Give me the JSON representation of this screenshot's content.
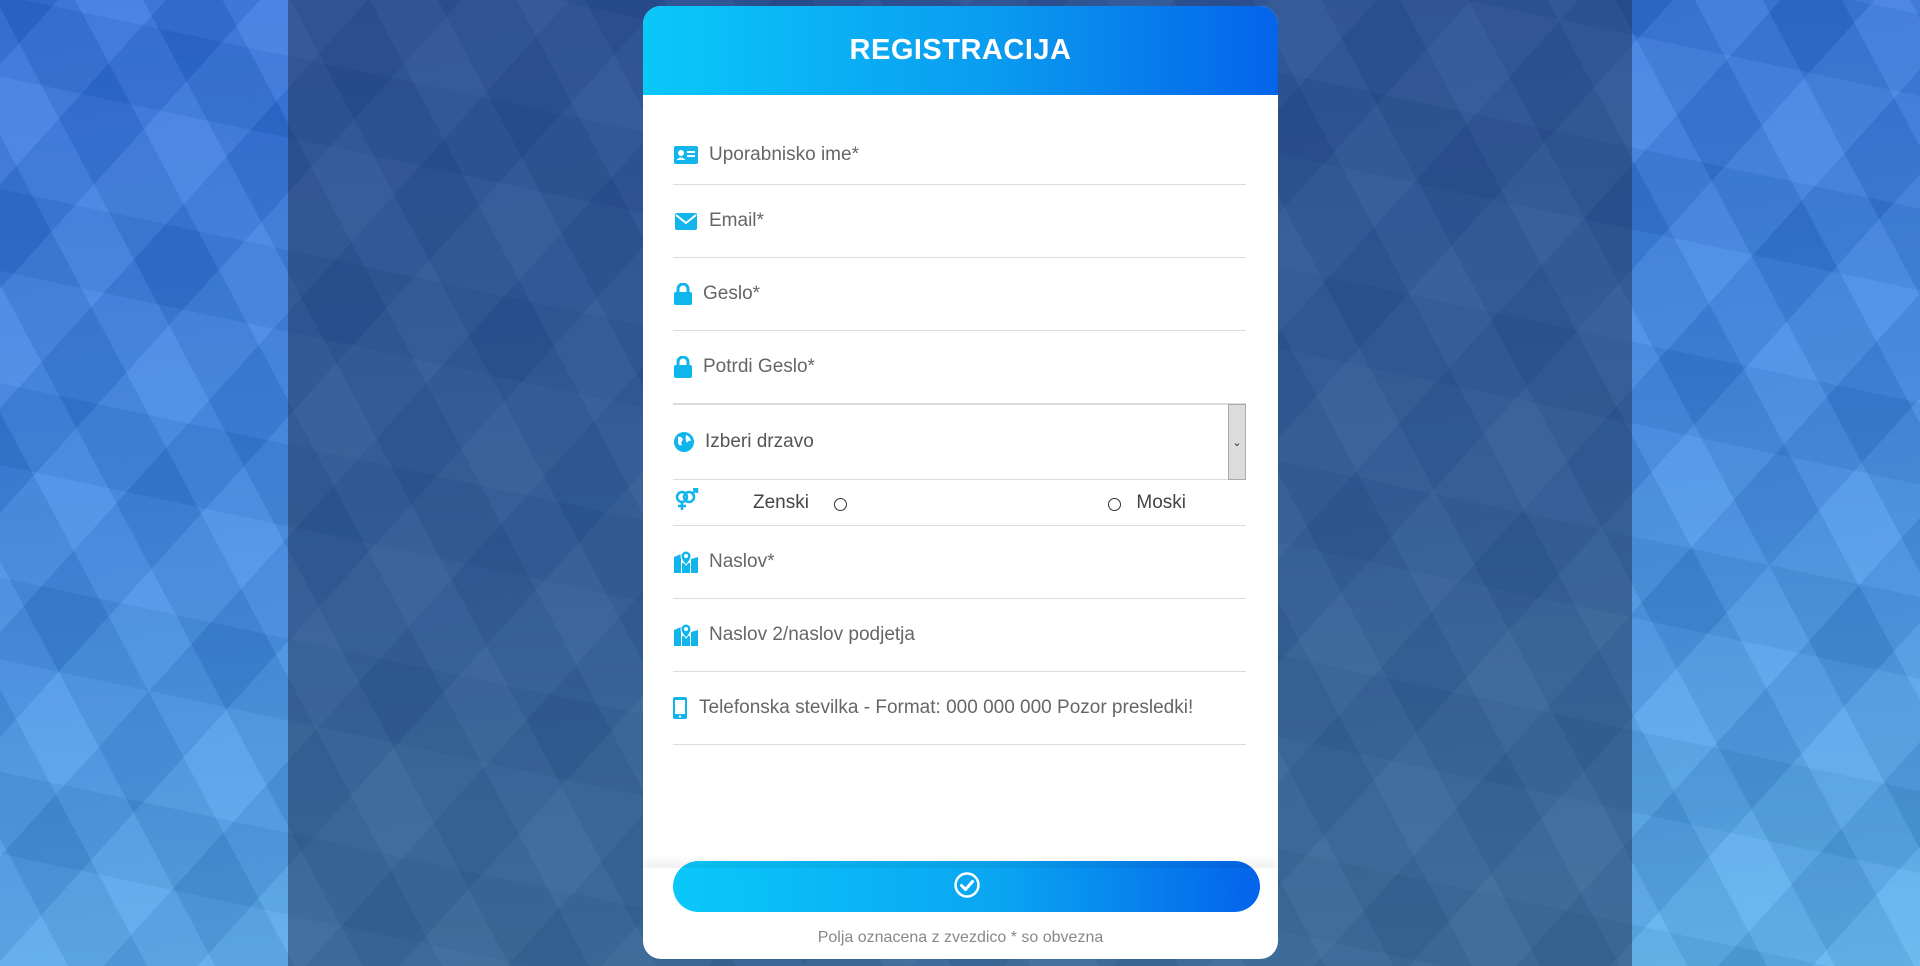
{
  "card": {
    "title": "REGISTRACIJA",
    "footer_note": "Polja oznacena z zvezdico * so obvezna"
  },
  "fields": {
    "username_placeholder": "Uporabnisko ime*",
    "email_placeholder": "Email*",
    "password_placeholder": "Geslo*",
    "confirm_password_placeholder": "Potrdi Geslo*",
    "country_select_value": "Izberi drzavo",
    "address_placeholder": "Naslov*",
    "address2_placeholder": "Naslov 2/naslov podjetja",
    "phone_placeholder": "Telefonska stevilka - Format: 000 000 000 Pozor presledki!"
  },
  "gender": {
    "female_label": "Zenski",
    "male_label": "Moski"
  },
  "colors": {
    "accent": "#10b5ec",
    "header_gradient_start": "#0ac8fa",
    "header_gradient_end": "#0463ea"
  },
  "icons": {
    "username": "id-card-icon",
    "email": "envelope-icon",
    "password": "lock-icon",
    "confirm_password": "lock-icon",
    "country": "globe-icon",
    "gender": "gender-icon",
    "address": "map-marker-icon",
    "address2": "map-marker-icon",
    "phone": "mobile-phone-icon",
    "submit": "check-circle-icon"
  }
}
